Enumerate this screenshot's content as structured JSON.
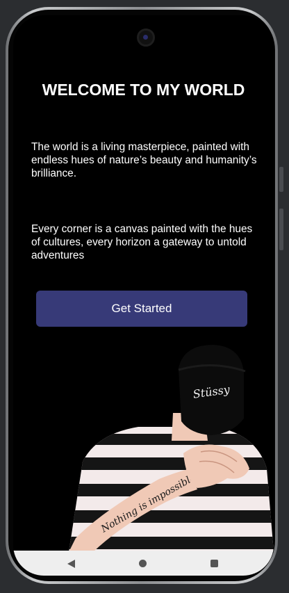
{
  "welcome": {
    "title": "WELCOME TO MY WORLD",
    "paragraph_1": " The world is a living masterpiece, painted with endless hues of nature’s beauty and humanity’s brilliance.",
    "paragraph_2": "Every corner is a canvas painted with the hues of cultures, every horizon a gateway to untold adventures",
    "cta_label": "Get Started"
  },
  "illustration": {
    "cap_logo_text": "Stüssy",
    "tattoo_text": "Nothing is impossible"
  },
  "colors": {
    "background": "#000000",
    "button": "#373a78",
    "text": "#ffffff",
    "nav_bar": "#eeeeee"
  },
  "icons": {
    "nav_back": "back-triangle-icon",
    "nav_home": "home-circle-icon",
    "nav_recents": "recents-square-icon"
  }
}
